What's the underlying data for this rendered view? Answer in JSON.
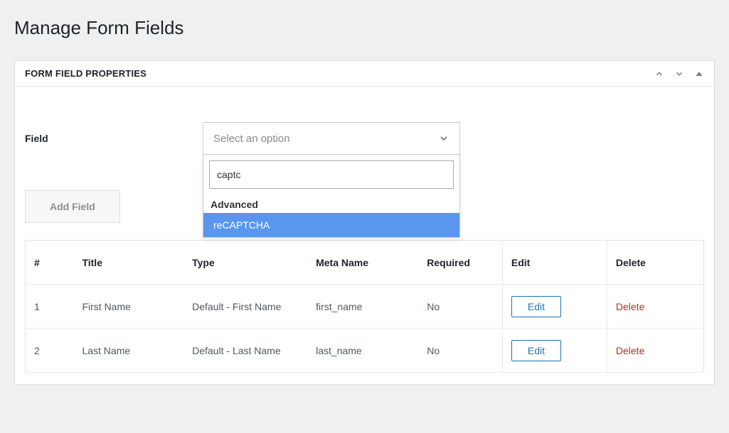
{
  "page": {
    "title": "Manage Form Fields"
  },
  "panel": {
    "title": "FORM FIELD PROPERTIES"
  },
  "field_selector": {
    "label": "Field",
    "placeholder": "Select an option",
    "search_value": "captc",
    "group_label": "Advanced",
    "option_highlighted": "reCAPTCHA"
  },
  "buttons": {
    "add_field": "Add Field",
    "edit": "Edit",
    "delete": "Delete"
  },
  "table": {
    "headers": {
      "index": "#",
      "title": "Title",
      "type": "Type",
      "meta": "Meta Name",
      "required": "Required",
      "edit": "Edit",
      "delete": "Delete"
    },
    "rows": [
      {
        "index": "1",
        "title": "First Name",
        "type": "Default - First Name",
        "meta": "first_name",
        "required": "No"
      },
      {
        "index": "2",
        "title": "Last Name",
        "type": "Default - Last Name",
        "meta": "last_name",
        "required": "No"
      }
    ]
  }
}
